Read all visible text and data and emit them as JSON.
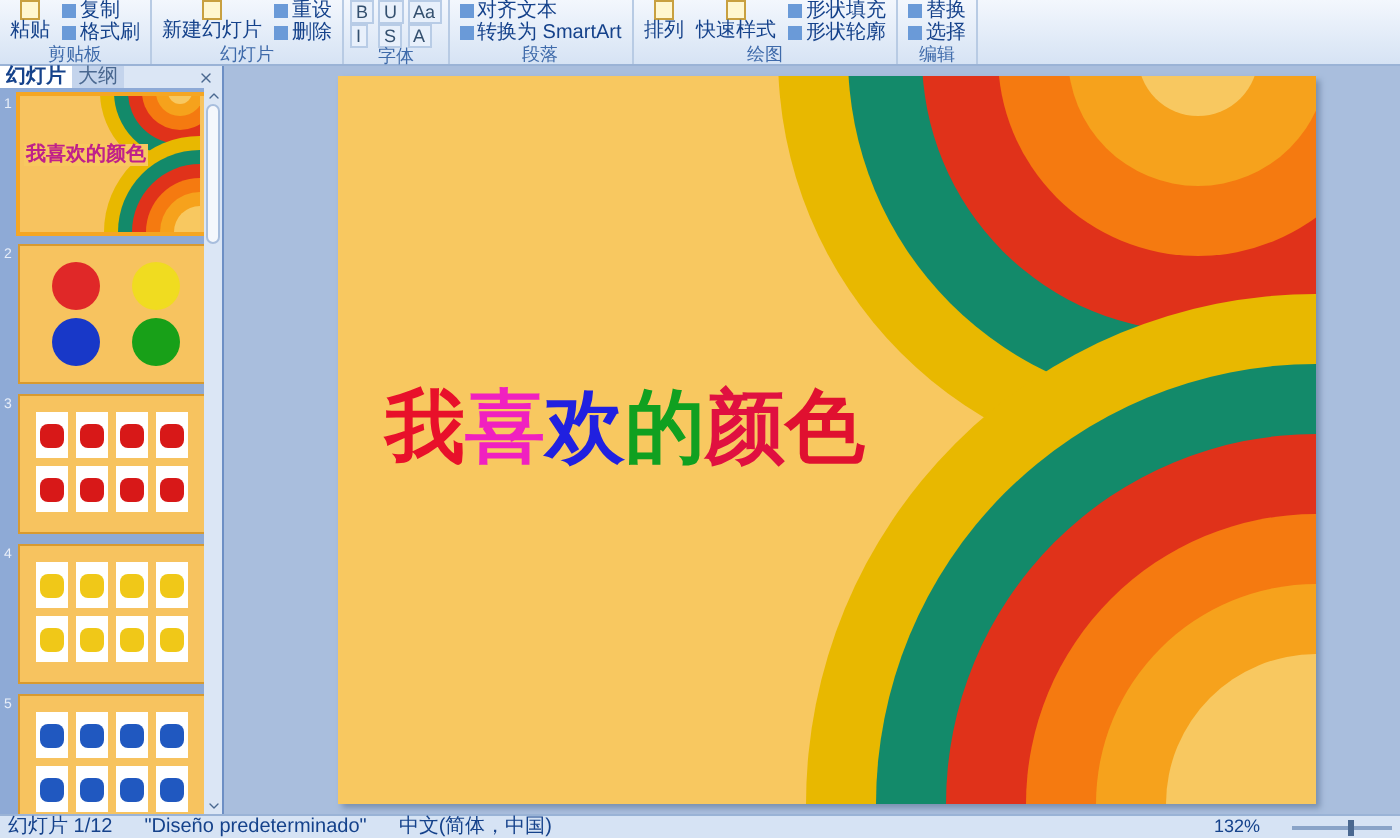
{
  "ribbon": {
    "groups": [
      {
        "label": "剪贴板",
        "buttons": [
          {
            "label": "粘贴",
            "kind": "large"
          },
          {
            "label": "复制",
            "kind": "small"
          },
          {
            "label": "格式刷",
            "kind": "small"
          }
        ]
      },
      {
        "label": "幻灯片",
        "buttons": [
          {
            "label": "新建幻灯片",
            "kind": "large"
          },
          {
            "label": "重设",
            "kind": "small"
          },
          {
            "label": "删除",
            "kind": "small"
          }
        ]
      },
      {
        "label": "字体",
        "buttons": [
          {
            "label": "B",
            "kind": "tool"
          },
          {
            "label": "I",
            "kind": "tool"
          },
          {
            "label": "U",
            "kind": "tool"
          },
          {
            "label": "S",
            "kind": "tool"
          },
          {
            "label": "Aa",
            "kind": "tool"
          },
          {
            "label": "A",
            "kind": "tool"
          }
        ]
      },
      {
        "label": "段落",
        "buttons": [
          {
            "label": "对齐文本",
            "kind": "small"
          },
          {
            "label": "转换为 SmartArt",
            "kind": "small"
          }
        ]
      },
      {
        "label": "绘图",
        "buttons": [
          {
            "label": "排列",
            "kind": "large"
          },
          {
            "label": "快速样式",
            "kind": "large"
          },
          {
            "label": "形状填充",
            "kind": "small"
          },
          {
            "label": "形状轮廓",
            "kind": "small"
          }
        ]
      },
      {
        "label": "编辑",
        "buttons": [
          {
            "label": "替换",
            "kind": "small"
          },
          {
            "label": "选择",
            "kind": "small"
          }
        ]
      }
    ]
  },
  "panel": {
    "tabs": [
      {
        "label": "幻灯片",
        "selected": true
      },
      {
        "label": "大纲",
        "selected": false
      }
    ],
    "thumbnails": [
      {
        "number": "1",
        "kind": "title",
        "selected": true,
        "title": "我喜欢的颜色"
      },
      {
        "number": "2",
        "kind": "smileys",
        "selected": false,
        "faces": [
          {
            "color": "#e02828"
          },
          {
            "color": "#f0dc20"
          },
          {
            "color": "#1838c8"
          },
          {
            "color": "#18a018"
          }
        ]
      },
      {
        "number": "3",
        "kind": "photos",
        "selected": false,
        "color": "#d81818"
      },
      {
        "number": "4",
        "kind": "photos",
        "selected": false,
        "color": "#f0c818"
      },
      {
        "number": "5",
        "kind": "photos",
        "selected": false,
        "color": "#2058c0"
      }
    ]
  },
  "slide": {
    "title": [
      {
        "text": "我",
        "color": "#e8102a"
      },
      {
        "text": "喜",
        "color": "#f020c0"
      },
      {
        "text": "欢",
        "color": "#2020e0"
      },
      {
        "text": "的",
        "color": "#10a020"
      },
      {
        "text": "颜",
        "color": "#e01040"
      },
      {
        "text": "色",
        "color": "#e01030"
      }
    ]
  },
  "status_bar": {
    "items": [
      "幻灯片 1/12",
      "\"Diseño predeterminado\"",
      "中文(简体，中国)"
    ],
    "zoom": "132%",
    "level": 0.55
  }
}
